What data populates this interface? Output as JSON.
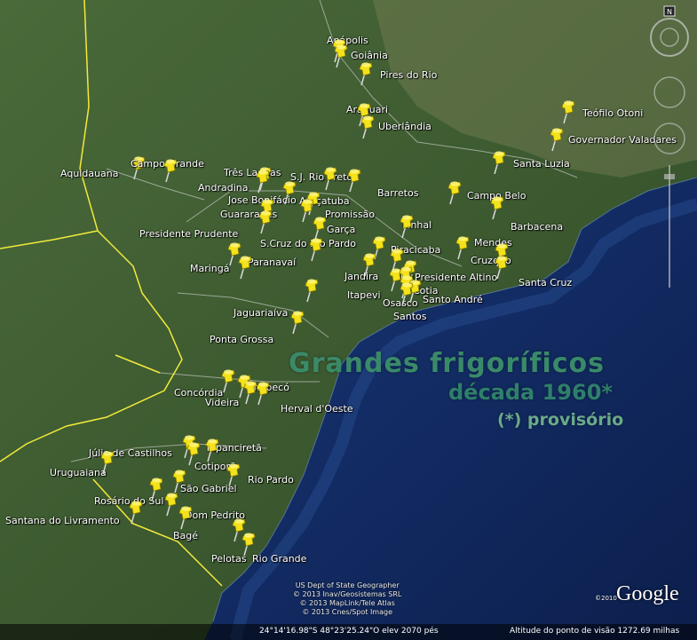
{
  "title": {
    "line1": "Grandes frigoríficos",
    "line2": "década 1960*",
    "line3": "(*) provisório"
  },
  "places": [
    {
      "name": "Anápolis"
    },
    {
      "name": "Goiânia"
    },
    {
      "name": "Pires do Rio"
    },
    {
      "name": "Araguari"
    },
    {
      "name": "Uberlândia"
    },
    {
      "name": "Teófilo Otoni"
    },
    {
      "name": "Governador Valadares"
    },
    {
      "name": "Aquidauana"
    },
    {
      "name": "Campo Grande"
    },
    {
      "name": "Três Lagoas"
    },
    {
      "name": "S.J. Rio Preto"
    },
    {
      "name": "Andradina"
    },
    {
      "name": "Barretos"
    },
    {
      "name": "Santa Luzia"
    },
    {
      "name": "Jose Bonifácio"
    },
    {
      "name": "Araçatuba"
    },
    {
      "name": "Campo Belo"
    },
    {
      "name": "Guararapes"
    },
    {
      "name": "Promissão"
    },
    {
      "name": "Barbacena"
    },
    {
      "name": "Pinhal"
    },
    {
      "name": "Garça"
    },
    {
      "name": "Presidente Prudente"
    },
    {
      "name": "S.Cruz do Rio Pardo"
    },
    {
      "name": "Piracicaba"
    },
    {
      "name": "Mendes"
    },
    {
      "name": "Cruzeiro"
    },
    {
      "name": "Maringá"
    },
    {
      "name": "Paranavaí"
    },
    {
      "name": "Jandira"
    },
    {
      "name": "Itu"
    },
    {
      "name": "Presidente Altino"
    },
    {
      "name": "Santa Cruz"
    },
    {
      "name": "Itapevi"
    },
    {
      "name": "Cotia"
    },
    {
      "name": "Osasco"
    },
    {
      "name": "Santo André"
    },
    {
      "name": "Santos"
    },
    {
      "name": "Jaguariaíva"
    },
    {
      "name": "Ponta Grossa"
    },
    {
      "name": "Concórdia"
    },
    {
      "name": "Chapecó"
    },
    {
      "name": "Videira"
    },
    {
      "name": "Herval d'Oeste"
    },
    {
      "name": "Júlio de Castilhos"
    },
    {
      "name": "Tupanciretã"
    },
    {
      "name": "Uruguaiana"
    },
    {
      "name": "Cotiporã"
    },
    {
      "name": "Rio Pardo"
    },
    {
      "name": "São Gabriel"
    },
    {
      "name": "Rosário do Sul"
    },
    {
      "name": "Dom Pedrito"
    },
    {
      "name": "Santana do Livramento"
    },
    {
      "name": "Bagé"
    },
    {
      "name": "Pelotas"
    },
    {
      "name": "Rio Grande"
    }
  ],
  "credits": [
    "US Dept of State Geographer",
    "© 2013 Inav/Geosistemas SRL",
    "© 2013 MapLink/Tele Atlas",
    "© 2013 Cnes/Spot Image"
  ],
  "google": {
    "logo": "Google",
    "year": "©2010"
  },
  "status": {
    "coords": "24°14'16.98\"S    48°23'25.24\"O  elev  2070 pés",
    "altitude": "Altitude do ponto de visão   1272.69 milhas"
  },
  "colors": {
    "pin": "#f4e21a",
    "ocean": "#15306a",
    "land": "#3f5a32"
  }
}
